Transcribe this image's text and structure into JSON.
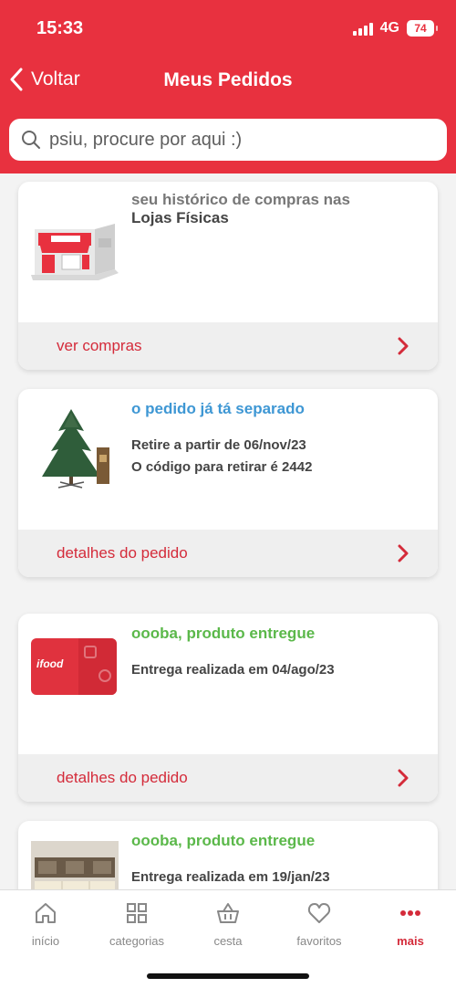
{
  "status_bar": {
    "time": "15:33",
    "network": "4G",
    "battery": "74"
  },
  "header": {
    "back_label": "Voltar",
    "title": "Meus Pedidos"
  },
  "search": {
    "placeholder": "psiu, procure por aqui :)"
  },
  "orders": [
    {
      "line1": "seu histórico de compras nas",
      "line2": "Lojas Físicas",
      "action": "ver compras"
    },
    {
      "status": "o pedido já tá separado",
      "status_color": "#3e97d4",
      "detail1": "Retire a partir de 06/nov/23",
      "detail2": "O código para retirar é 2442",
      "action": "detalhes do pedido"
    },
    {
      "status": "oooba, produto entregue",
      "status_color": "#5bb84a",
      "detail1": "Entrega realizada em 04/ago/23",
      "thumb_text": "ifood",
      "action": "detalhes do pedido"
    },
    {
      "status": "oooba, produto entregue",
      "status_color": "#5bb84a",
      "detail1": "Entrega realizada em 19/jan/23"
    }
  ],
  "tabbar": {
    "items": [
      {
        "label": "início",
        "icon": "home-icon"
      },
      {
        "label": "categorias",
        "icon": "grid-icon"
      },
      {
        "label": "cesta",
        "icon": "basket-icon"
      },
      {
        "label": "favoritos",
        "icon": "heart-icon"
      },
      {
        "label": "mais",
        "icon": "more-dots-icon",
        "active": true
      }
    ]
  },
  "colors": {
    "brand": "#e8313f",
    "action": "#d42b3a"
  }
}
